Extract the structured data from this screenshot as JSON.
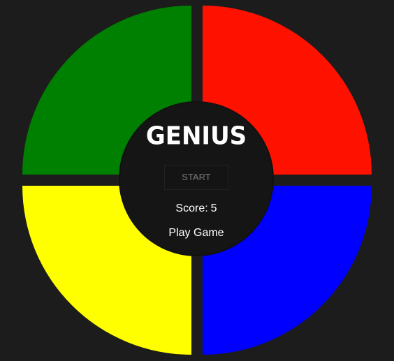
{
  "game": {
    "title": "GENIUS",
    "start_label": "START",
    "score_label": "Score:",
    "score_value": "5",
    "status_text": "Play Game"
  },
  "pads": {
    "green": {
      "color": "#008000"
    },
    "red": {
      "color": "#ff1100"
    },
    "yellow": {
      "color": "#ffff00"
    },
    "blue": {
      "color": "#0000ff"
    }
  },
  "colors": {
    "background": "#1c1c1c",
    "center": "#151515"
  }
}
